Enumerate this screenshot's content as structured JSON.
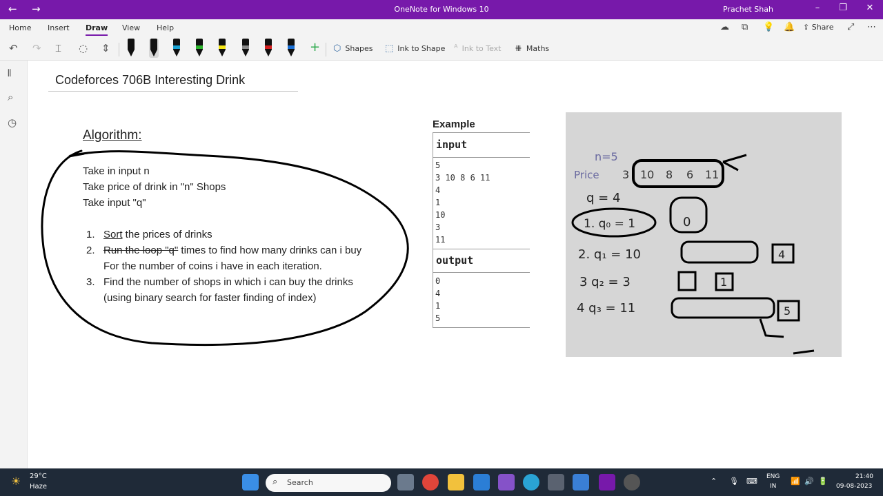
{
  "titlebar": {
    "app_title": "OneNote for Windows 10",
    "user": "Prachet Shah"
  },
  "tabs": [
    "Home",
    "Insert",
    "Draw",
    "View",
    "Help"
  ],
  "share_label": "Share",
  "toolbar": {
    "shapes": "Shapes",
    "ink_to_shape": "Ink to Shape",
    "ink_to_text": "Ink to Text",
    "maths": "Maths",
    "pen_colors": [
      "#111111",
      "#111111",
      "#1aa3d4",
      "#2db52d",
      "#f5e614",
      "#888888",
      "#d42020",
      "#1a6fd4"
    ]
  },
  "page": {
    "title": "Codeforces 706B Interesting Drink",
    "algorithm_heading": "Algorithm:",
    "lines": [
      "Take in input n",
      "Take price of drink in \"n\" Shops",
      "Take input \"q\""
    ],
    "steps": {
      "n1": "1.",
      "s1_word": "Sort",
      "s1_rest": " the prices of drinks",
      "n2": "2.",
      "s2_struck": "Run the loop \"q\"",
      "s2_rest": " times to find how many drinks can i buy",
      "s2_line2": "For the number of coins i have in each iteration.",
      "n3": "3.",
      "s3": "Find the number of shops in which i can buy the drinks",
      "s3_line2": "(using binary search for faster finding of index)"
    }
  },
  "example": {
    "heading": "Example",
    "input_label": "input",
    "input_values": [
      "5",
      "3 10 8 6 11",
      "4",
      "1",
      "10",
      "3",
      "11"
    ],
    "output_label": "output",
    "output_values": [
      "0",
      "4",
      "1",
      "5"
    ]
  },
  "photo_notes": {
    "n": "n=5",
    "price": "Price",
    "prices": [
      "3",
      "10",
      "8",
      "6",
      "11"
    ],
    "q": "q = 4",
    "queries": [
      "1. q₀ = 1",
      "2. q₁ = 10",
      "3 q₂ = 3",
      "4 q₃ = 11"
    ],
    "results": [
      "0",
      "4",
      "1",
      "5"
    ]
  },
  "taskbar": {
    "temp": "29°C",
    "weather": "Haze",
    "search": "Search",
    "lang1": "ENG",
    "lang2": "IN",
    "time": "21:40",
    "date": "09-08-2023"
  }
}
